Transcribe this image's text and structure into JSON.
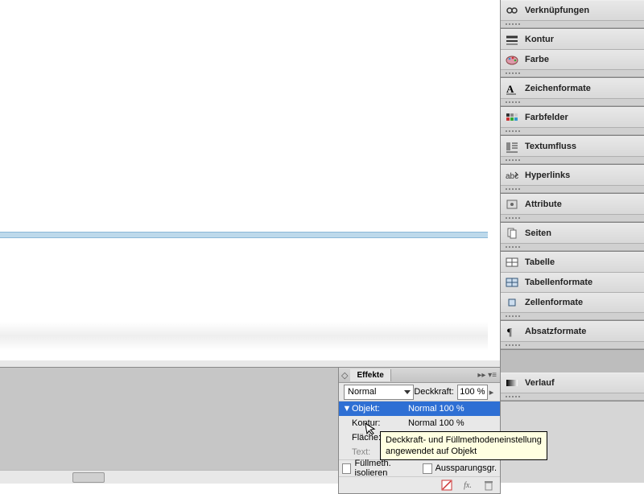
{
  "sidebar": {
    "groups": [
      [
        {
          "icon": "links",
          "label": "Verknüpfungen"
        }
      ],
      [
        {
          "icon": "stroke",
          "label": "Kontur"
        },
        {
          "icon": "color",
          "label": "Farbe"
        }
      ],
      [
        {
          "icon": "charstyle",
          "label": "Zeichenformate"
        }
      ],
      [
        {
          "icon": "swatches",
          "label": "Farbfelder"
        }
      ],
      [
        {
          "icon": "textwrap",
          "label": "Textumfluss"
        }
      ],
      [
        {
          "icon": "hyperlinks",
          "label": "Hyperlinks"
        }
      ],
      [
        {
          "icon": "attributes",
          "label": "Attribute"
        }
      ],
      [
        {
          "icon": "pages",
          "label": "Seiten"
        }
      ],
      [
        {
          "icon": "table",
          "label": "Tabelle"
        },
        {
          "icon": "tablestyles",
          "label": "Tabellenformate"
        },
        {
          "icon": "cellstyles",
          "label": "Zellenformate"
        }
      ],
      [
        {
          "icon": "parastyles",
          "label": "Absatzformate"
        }
      ],
      [
        {
          "icon": "gradient",
          "label": "Verlauf"
        }
      ]
    ]
  },
  "effects": {
    "title": "Effekte",
    "blend_mode": "Normal",
    "opacity_label": "Deckkraft:",
    "opacity_value": "100 %",
    "rows": [
      {
        "name": "Objekt:",
        "value": "Normal 100 %",
        "selected": true,
        "twisty": "▼"
      },
      {
        "name": "Kontur:",
        "value": "Normal 100 %",
        "selected": false,
        "twisty": ""
      },
      {
        "name": "Fläche:",
        "value": "",
        "selected": false,
        "twisty": ""
      },
      {
        "name": "Text:",
        "value": "",
        "selected": false,
        "twisty": "",
        "dim": true
      }
    ],
    "isolate_label": "Füllmeth. isolieren",
    "knockout_label": "Aussparungsgr."
  },
  "tooltip": {
    "line1": "Deckkraft- und Füllmethodeneinstellung",
    "line2": "angewendet auf Objekt"
  }
}
